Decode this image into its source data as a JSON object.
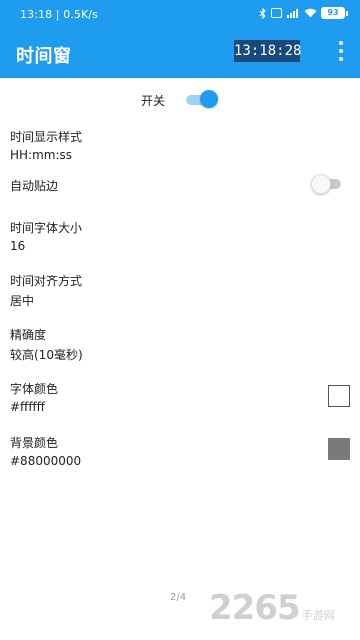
{
  "status_bar": {
    "time": "13:18",
    "network_speed": "0.5K/s",
    "separator": " | ",
    "icons": [
      "bluetooth-icon",
      "hd-icon",
      "signal-4g-icon",
      "wifi-icon"
    ],
    "hd_label": "HD",
    "signal_label": "4G",
    "battery_level": "93"
  },
  "app_bar": {
    "title": "时间窗",
    "clock": "13:18:28"
  },
  "master_switch": {
    "label": "开关",
    "state": "on"
  },
  "settings": [
    {
      "title": "时间显示样式",
      "value": "HH:mm:ss"
    },
    {
      "title": "自动贴边",
      "switch_state": "off"
    },
    {
      "title": "时间字体大小",
      "value": "16"
    },
    {
      "title": "时间对齐方式",
      "value": "居中"
    },
    {
      "title": "精确度",
      "value": "较高(10毫秒)"
    },
    {
      "title": "字体颜色",
      "value": "#ffffff",
      "swatch_color": "#ffffff"
    },
    {
      "title": "背景颜色",
      "value": "#88000000",
      "swatch_color": "#7a7a7a"
    }
  ],
  "page_indicator": "2/4",
  "watermark": {
    "number": "2265",
    "suffix": "手游网"
  },
  "colors": {
    "accent": "#1e9cf0",
    "clock_background": "#174a7b"
  }
}
